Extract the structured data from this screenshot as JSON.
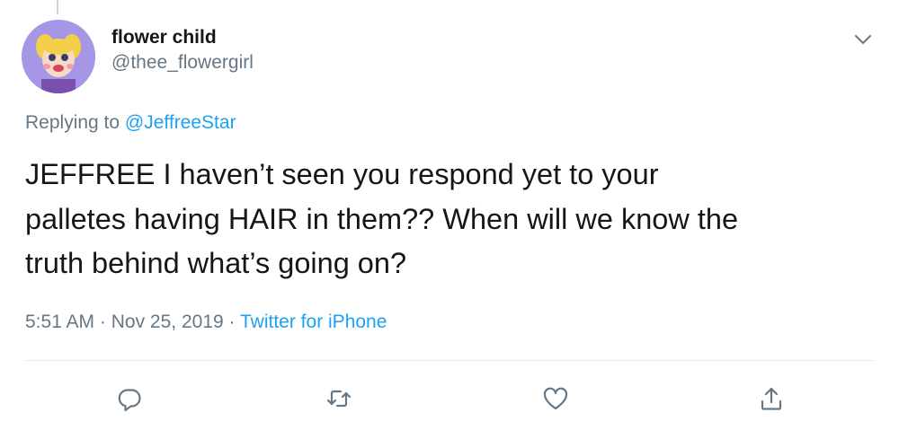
{
  "tweet": {
    "display_name": "flower child",
    "handle": "@thee_flowergirl",
    "replying_prefix": "Replying to",
    "replying_to": "@JeffreeStar",
    "text": "JEFFREE I haven’t seen you respond yet to your\npalletes having HAIR in them?? When will we know the\ntruth behind what’s going on?",
    "time": "5:51 AM",
    "date": "Nov 25, 2019",
    "separator": "·",
    "source": "Twitter for iPhone"
  },
  "icons": {
    "menu": "chevron-down-icon",
    "reply": "reply-icon",
    "retweet": "retweet-icon",
    "like": "heart-icon",
    "share": "share-icon"
  },
  "colors": {
    "link": "#1da1f2",
    "secondary_text": "#657786",
    "primary_text": "#14171a",
    "divider": "#e6ecf0"
  }
}
